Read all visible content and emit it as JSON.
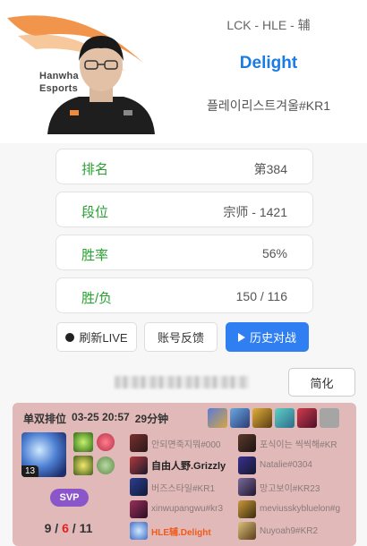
{
  "header": {
    "team_logo_text": [
      "Hanwha",
      "Esports"
    ],
    "team_role": "LCK - HLE - 辅",
    "player_name": "Delight",
    "riot_id": "플레이리스트겨울#KR1"
  },
  "stats": [
    {
      "label": "排名",
      "value": "第384"
    },
    {
      "label": "段位",
      "value": "宗师 - 1421"
    },
    {
      "label": "胜率",
      "value": "56%"
    },
    {
      "label": "胜/负",
      "value": "150 / 116"
    }
  ],
  "buttons": {
    "refresh": "刷新LIVE",
    "feedback": "账号反馈",
    "history": "历史对战",
    "simplify": "简化"
  },
  "match": {
    "queue": "单双排位",
    "date": "03-25 20:57",
    "duration": "29分钟",
    "champion_level": "13",
    "badge": "SVP",
    "kda": {
      "kills": "9",
      "deaths": "6",
      "assists": "11"
    },
    "colors": {
      "loss_bg": "#e1b9b9",
      "me": "#f05a1a",
      "deaths": "#e32222"
    },
    "team_left": [
      {
        "name": "안되면죽지뭐#000"
      },
      {
        "name": "自由人野.Grizzly"
      },
      {
        "name": "버즈스타일#KR1"
      },
      {
        "name": "xinwupangwu#kr3"
      },
      {
        "name": "HLE辅.Delight"
      }
    ],
    "team_right": [
      {
        "name": "포식이는 씩씩해#KR"
      },
      {
        "name": "Natalie#0304"
      },
      {
        "name": "망고보이#KR23"
      },
      {
        "name": "meviusskybluelon#g"
      },
      {
        "name": "Nuyoah9#KR2"
      }
    ]
  }
}
